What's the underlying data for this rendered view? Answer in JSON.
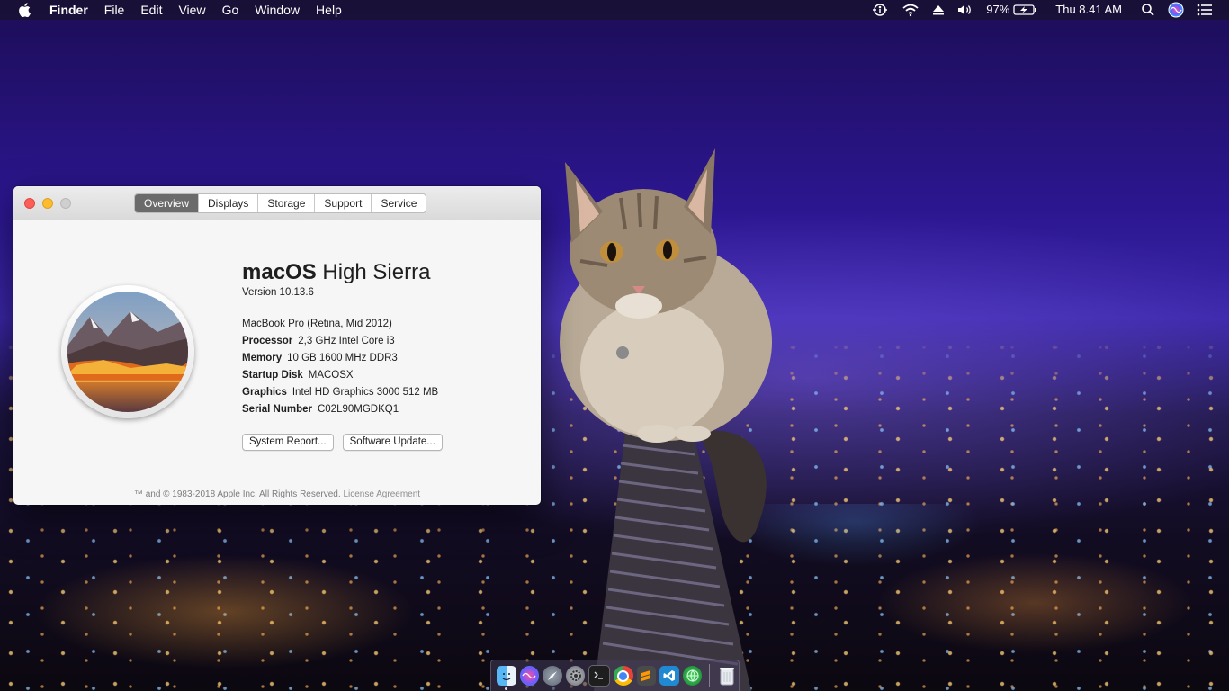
{
  "menubar": {
    "apple_icon": "apple-icon",
    "app_name": "Finder",
    "menus": [
      "File",
      "Edit",
      "View",
      "Go",
      "Window",
      "Help"
    ],
    "status": {
      "battery_percent": "97%",
      "clock": "Thu 8.41 AM",
      "icons": [
        "accessibility-icon",
        "wifi-icon",
        "eject-icon",
        "volume-icon",
        "battery-charging-icon",
        "spotlight-search-icon",
        "siri-icon",
        "notification-center-icon"
      ]
    }
  },
  "about_window": {
    "tabs": [
      {
        "label": "Overview",
        "active": true
      },
      {
        "label": "Displays",
        "active": false
      },
      {
        "label": "Storage",
        "active": false
      },
      {
        "label": "Support",
        "active": false
      },
      {
        "label": "Service",
        "active": false
      }
    ],
    "os_name_bold": "macOS",
    "os_name_light": "High Sierra",
    "version": "Version 10.13.6",
    "model": "MacBook Pro (Retina, Mid 2012)",
    "specs": [
      {
        "key": "Processor",
        "value": "2,3 GHz Intel Core i3"
      },
      {
        "key": "Memory",
        "value": "10 GB 1600 MHz DDR3"
      },
      {
        "key": "Startup Disk",
        "value": "MACOSX"
      },
      {
        "key": "Graphics",
        "value": "Intel HD Graphics 3000 512 MB"
      },
      {
        "key": "Serial Number",
        "value": "C02L90MGDKQ1"
      }
    ],
    "buttons": {
      "system_report": "System Report...",
      "software_update": "Software Update..."
    },
    "footer_text": "™ and © 1983-2018 Apple Inc. All Rights Reserved.",
    "footer_link": "License Agreement"
  },
  "dock": {
    "apps": [
      "finder-icon",
      "siri-icon",
      "launchpad-icon",
      "system-preferences-icon",
      "terminal-icon",
      "chrome-icon",
      "sublime-text-icon",
      "vscode-icon",
      "network-globe-icon"
    ],
    "trash": "trash-icon"
  },
  "colors": {
    "menubar_bg": "#181230",
    "tab_active": "#6b6b6b",
    "close": "#fc5f57",
    "minimize": "#fdbc2e",
    "zoom_disabled": "#cfcfcf"
  }
}
